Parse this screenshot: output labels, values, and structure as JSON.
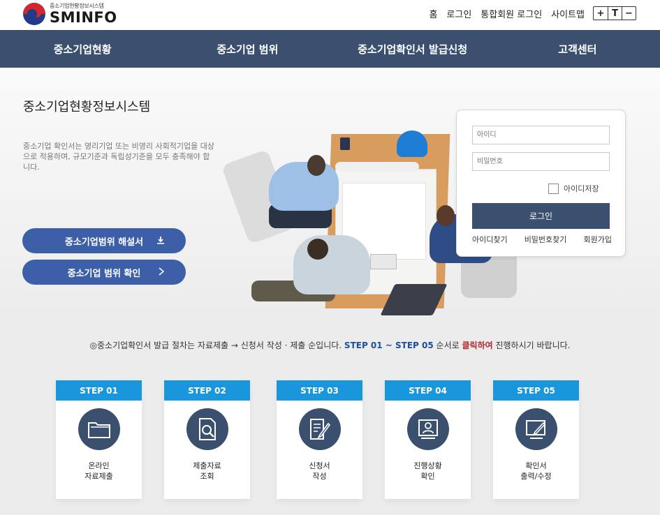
{
  "header": {
    "logo_sub": "중소기업현황정보시스템",
    "logo_main": "SMINFO",
    "util_links": [
      "홈",
      "로그인",
      "통합회원 로그인",
      "사이트맵"
    ],
    "font_controls": [
      "+",
      "T",
      "−"
    ]
  },
  "nav": {
    "items": [
      "중소기업현황",
      "중소기업 범위",
      "중소기업확인서 발급신청",
      "고객센터"
    ]
  },
  "hero": {
    "title": "중소기업현황정보시스템",
    "description": "중소기업 확인서는 영리기업 또는 비영리 사회적기업을 대상으로 적용하며, 규모기준과 독립성기준을 모두 충족해야 합니다.",
    "btn_guide": "중소기업범위 해설서",
    "btn_check": "중소기업 범위 확인"
  },
  "login": {
    "id_placeholder": "아이디",
    "pw_placeholder": "비밀번호",
    "save_id": "아이디저장",
    "login_button": "로그인",
    "links": [
      "아이디찾기",
      "비밀번호찾기",
      "회원가입"
    ]
  },
  "notice": {
    "part1": "◎중소기업확인서 발급 절차는 자료제출 → 신청서 작성 · 제출 순입니다.",
    "part2": "STEP 01 ~ STEP 05",
    "part3": " 순서로 ",
    "part4": "클릭하여",
    "part5": " 진행하시기 바랍니다."
  },
  "steps": [
    {
      "label": "STEP 01",
      "line1": "온라인",
      "line2": "자료제출",
      "icon": "folder-icon"
    },
    {
      "label": "STEP 02",
      "line1": "제출자료",
      "line2": "조회",
      "icon": "document-search-icon"
    },
    {
      "label": "STEP 03",
      "line1": "신청서",
      "line2": "작성",
      "icon": "document-edit-icon"
    },
    {
      "label": "STEP 04",
      "line1": "진행상황",
      "line2": "확인",
      "icon": "progress-monitor-icon"
    },
    {
      "label": "STEP 05",
      "line1": "확인서",
      "line2": "출력/수정",
      "icon": "print-edit-icon"
    }
  ],
  "colors": {
    "nav_bg": "#3b506e",
    "step_label": "#1a96dc",
    "button_blue": "#3d5fa8",
    "notice_blue": "#1d4e9a",
    "notice_red": "#b3262c"
  }
}
